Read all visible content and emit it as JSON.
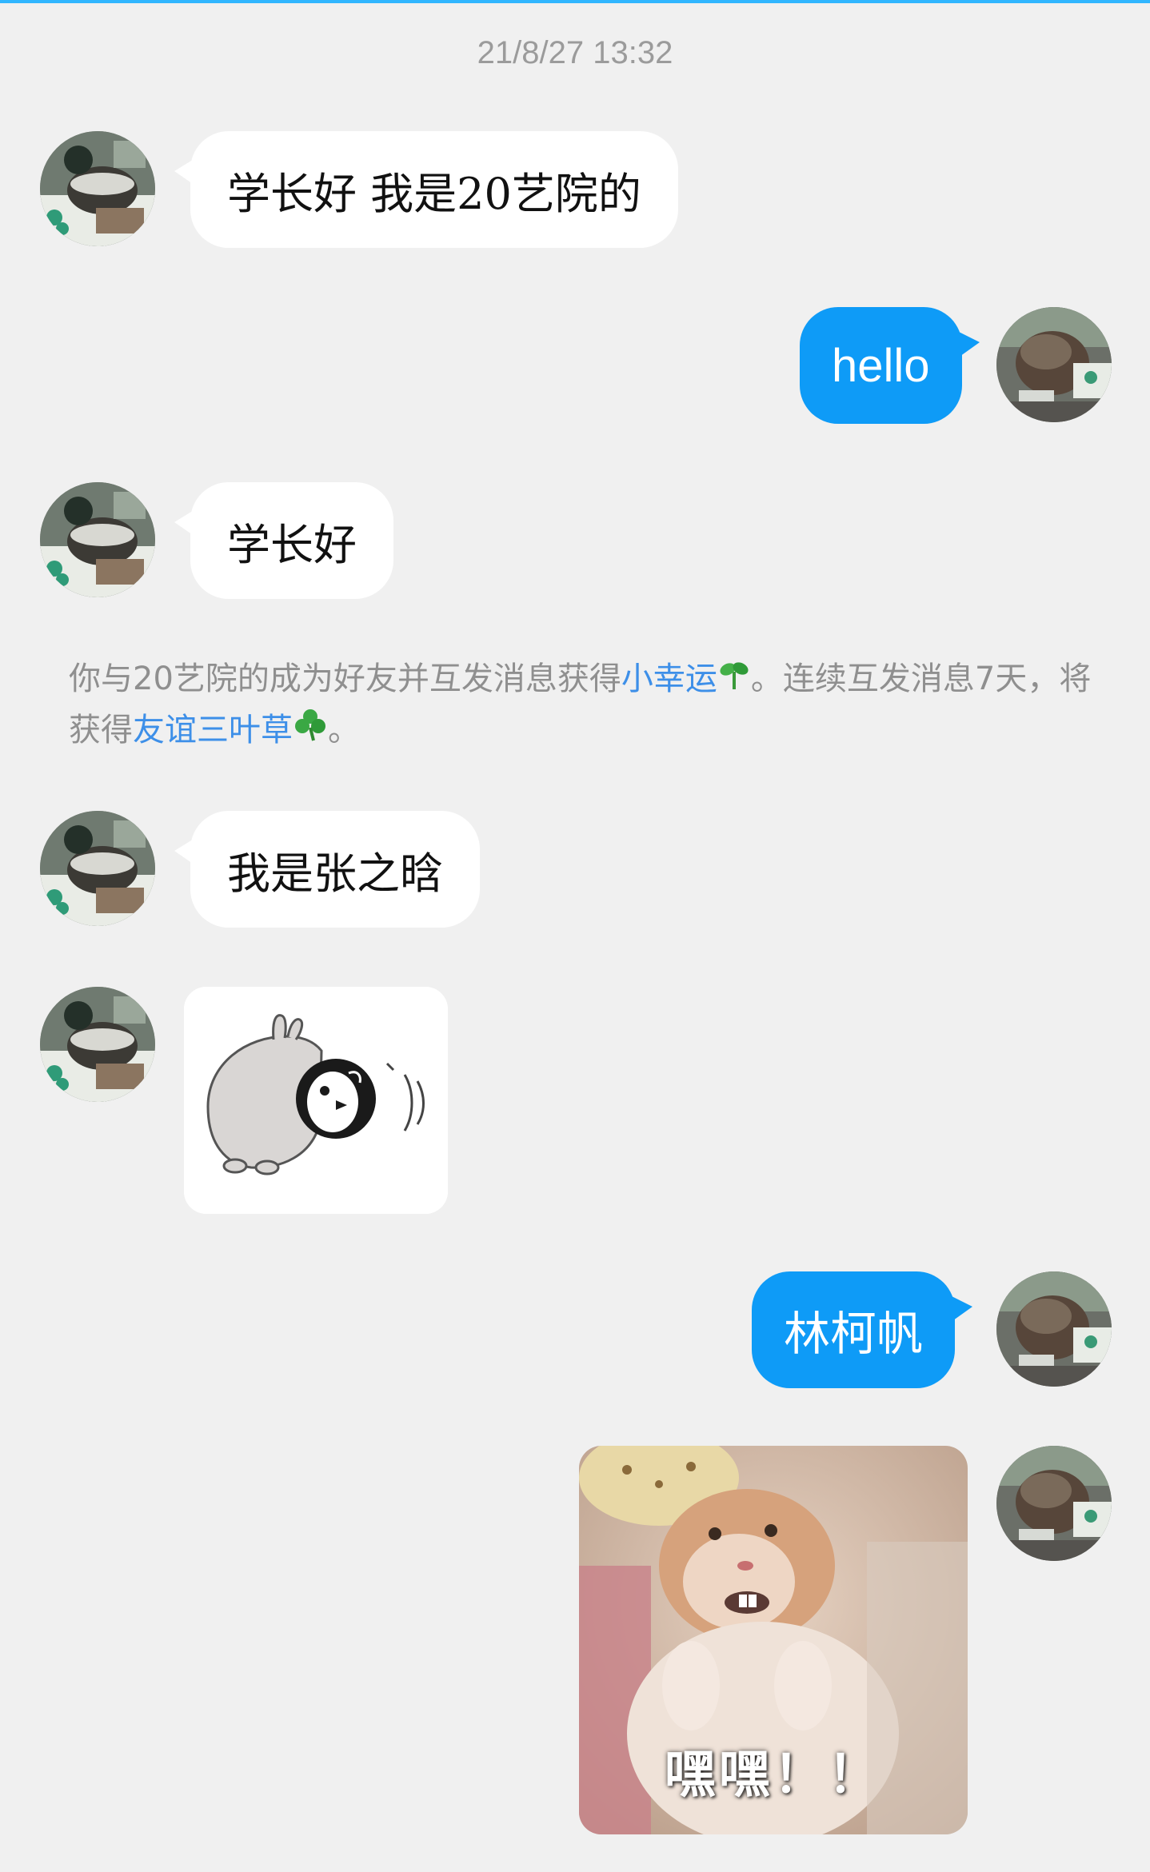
{
  "theme": {
    "background": "#f0f0f0",
    "incoming_bubble": "#ffffff",
    "outgoing_bubble": "#0e9bf7",
    "link_color": "#3d8fe8",
    "notice_color": "#8f8f8f"
  },
  "header": {
    "timestamp": "21/8/27 13:32"
  },
  "messages": [
    {
      "sender": "them",
      "type": "text",
      "text": "学长好  我是20艺院的"
    },
    {
      "sender": "me",
      "type": "text",
      "text": "hello"
    },
    {
      "sender": "them",
      "type": "text",
      "text": "学长好"
    },
    {
      "sender": "them",
      "type": "text",
      "text": "我是张之晗"
    },
    {
      "sender": "them",
      "type": "sticker",
      "sticker": "penguin-bunny-sticker"
    },
    {
      "sender": "me",
      "type": "text",
      "text": "林柯帆"
    },
    {
      "sender": "me",
      "type": "sticker",
      "sticker": "hamster-sticker",
      "caption": "嘿嘿！！"
    }
  ],
  "system_notice": {
    "part1": "你与20艺院的成为好友并互发消息获得",
    "link1": "小幸运",
    "link1_icon": "sprout-icon",
    "part2": "。连续互发消息7天，将获得",
    "link2": "友谊三叶草",
    "link2_icon": "clover-icon",
    "part3": "。"
  }
}
